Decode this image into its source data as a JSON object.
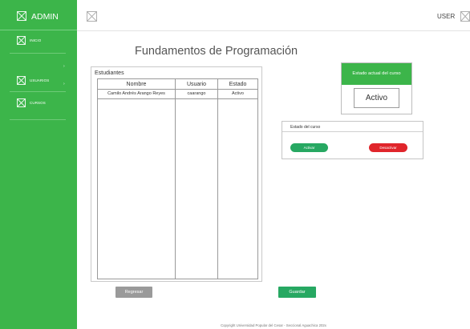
{
  "sidebar": {
    "brand": "ADMIN",
    "brand_icon": "image-placeholder-icon",
    "items": [
      {
        "label": "INICIO",
        "icon": "image-placeholder-icon"
      },
      {
        "label": "USUARIOS",
        "icon": "image-placeholder-icon"
      },
      {
        "label": "CURSOS",
        "icon": "image-placeholder-icon"
      }
    ],
    "arrow_glyph": "›"
  },
  "header": {
    "user_label": "USER",
    "placeholder_icon": "image-placeholder-icon"
  },
  "page": {
    "title": "Fundamentos de Programación"
  },
  "students": {
    "title": "Estudiantes",
    "columns": [
      "Nombre",
      "Usuario",
      "Estado"
    ],
    "rows": [
      [
        "Camilo Andrés Arango Reyes",
        "caarango",
        "Activo"
      ]
    ]
  },
  "status_card": {
    "title": "Estado actual del curso",
    "value": "Activo"
  },
  "course_state": {
    "title": "Estado del curso",
    "activate_label": "Activar",
    "deactivate_label": "Desactivar"
  },
  "actions": {
    "back_label": "Regresar",
    "save_label": "Guardar"
  },
  "footer": {
    "text": "Copyright Universidad Popular del Cesar - Seccional Aguachica 202x"
  },
  "colors": {
    "sidebar": "#3cb54a",
    "status_header": "#3cb54a",
    "activate": "#27a862",
    "deactivate": "#e0252b",
    "save": "#27a862",
    "back": "#9a9a9a"
  }
}
